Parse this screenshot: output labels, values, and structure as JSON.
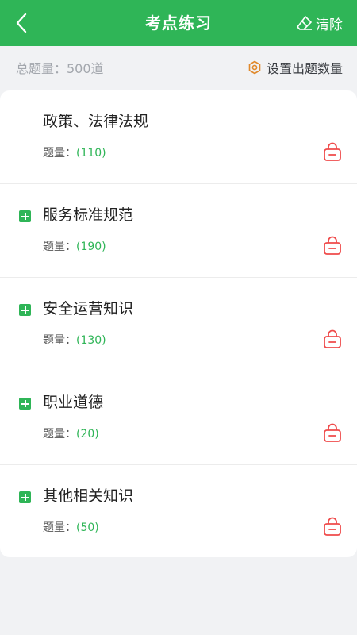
{
  "header": {
    "title": "考点练习",
    "clear_label": "清除"
  },
  "summary": {
    "total_text": "总题量：500道",
    "settings_label": "设置出题数量"
  },
  "count_label": "题量：",
  "categories": [
    {
      "title": "政策、法律法规",
      "count": "(110)",
      "expandable": false
    },
    {
      "title": "服务标准规范",
      "count": "(190)",
      "expandable": true
    },
    {
      "title": "安全运营知识",
      "count": "(130)",
      "expandable": true
    },
    {
      "title": "职业道德",
      "count": "(20)",
      "expandable": true
    },
    {
      "title": "其他相关知识",
      "count": "(50)",
      "expandable": true
    }
  ],
  "colors": {
    "brand": "#2fb557",
    "lock": "#ef4b4b"
  },
  "icons": {
    "back": "back-arrow-icon",
    "clear": "eraser-icon",
    "settings": "gear-icon",
    "expand": "plus-square-icon",
    "locked": "lock-icon"
  }
}
